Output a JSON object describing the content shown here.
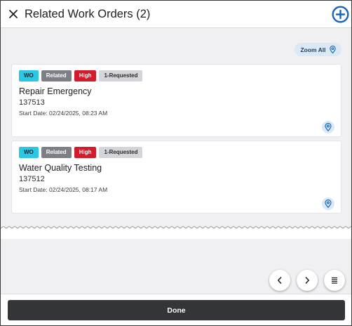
{
  "header": {
    "title": "Related Work Orders (2)",
    "close_icon": "close-icon",
    "add_icon": "add-circle-icon"
  },
  "toolbar": {
    "zoom_all_label": "Zoom All",
    "zoom_all_icon": "map-pin-icon"
  },
  "work_orders": [
    {
      "badges": [
        "WO",
        "Related",
        "High",
        "1-Requested"
      ],
      "title": "Repair Emergency",
      "number": "137513",
      "start_date": "Start Date: 02/24/2025, 08:23 AM"
    },
    {
      "badges": [
        "WO",
        "Related",
        "High",
        "1-Requested"
      ],
      "title": "Water Quality Testing",
      "number": "137512",
      "start_date": "Start Date: 02/24/2025, 08:17 AM"
    }
  ],
  "nav": {
    "prev_icon": "chevron-left-icon",
    "next_icon": "chevron-right-icon",
    "list_icon": "list-icon"
  },
  "footer": {
    "done_label": "Done"
  },
  "colors": {
    "accent_blue": "#1565c0",
    "wo_badge": "#2dc7e6",
    "related_badge": "#7c7f86",
    "high_badge": "#d21c2c",
    "status_badge": "#d4d5da",
    "done_button": "#343538"
  }
}
